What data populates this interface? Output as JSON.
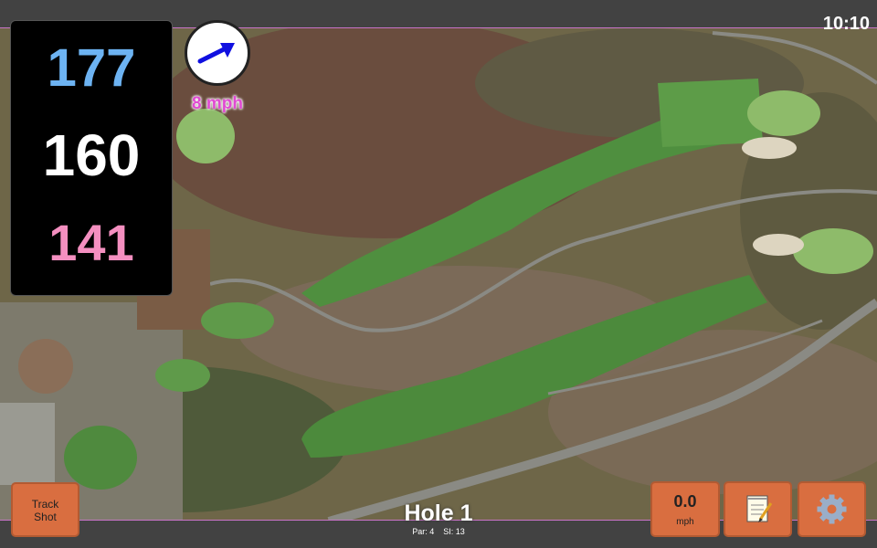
{
  "clock": "10:10",
  "distances": {
    "back": "177",
    "middle": "160",
    "front": "141"
  },
  "wind": {
    "speed": "8 mph",
    "icon": "wind-arrow-icon",
    "direction_color": "#1010e0"
  },
  "buttons": {
    "track_shot_line1": "Track",
    "track_shot_line2": "Shot",
    "speed_value": "0.0",
    "speed_unit": "mph",
    "notes_icon": "notepad-icon",
    "settings_icon": "gear-icon"
  },
  "hole": {
    "title": "Hole 1",
    "par": "Par: 4",
    "si": "SI: 13"
  },
  "colors": {
    "button": "#d96e40",
    "back_distance": "#6db3f2",
    "front_distance": "#f48fc0",
    "wind_label": "#e04ad2"
  }
}
